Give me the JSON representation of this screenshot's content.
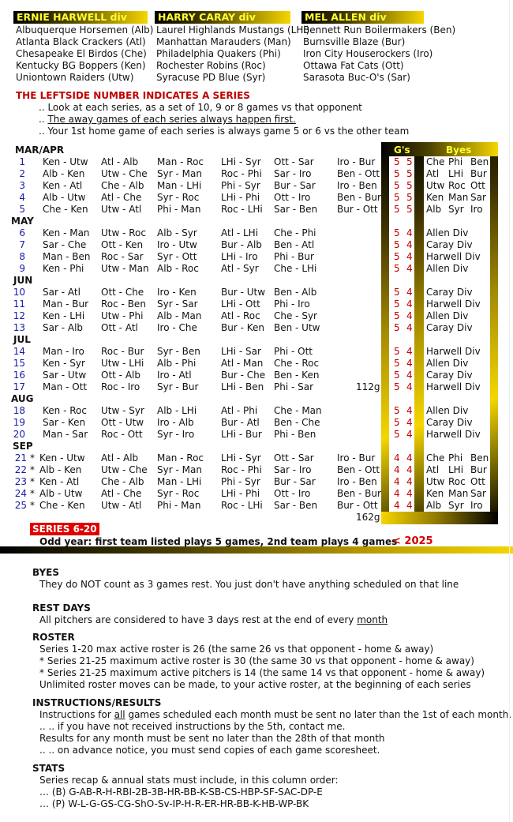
{
  "divisions": [
    {
      "title": "ERNIE HARWELL div",
      "teams": [
        "Albuquerque Horsemen (Alb)",
        "Atlanta Black Crackers (Atl)",
        "Chesapeake El Birdos (Che)",
        "Kentucky BG Boppers (Ken)",
        "Uniontown Raiders (Utw)"
      ]
    },
    {
      "title": "HARRY CARAY div",
      "teams": [
        "Laurel Highlands Mustangs (LHi)",
        "Manhattan Marauders (Man)",
        "Philadelphia Quakers (Phi)",
        "Rochester Robins (Roc)",
        "Syracuse PD Blue (Syr)"
      ]
    },
    {
      "title": "MEL ALLEN div",
      "teams": [
        "Bennett Run Boilermakers (Ben)",
        "Burnsville Blaze (Bur)",
        "Iron City Houserockers (Iro)",
        "Ottawa Fat Cats (Ott)",
        "Sarasota Buc-O's (Sar)"
      ]
    }
  ],
  "intro": {
    "heading": "THE LEFTSIDE NUMBER INDICATES A SERIES",
    "lines": [
      ".. Look at each series, as a set of 10, 9 or 8 games vs that opponent",
      ".. ",
      "The away games of each series always happen first.",
      ".. Your 1st home game of each series is always game 5 or 6 vs the other team"
    ]
  },
  "panel": {
    "games_header": "G's",
    "byes_header": "Byes"
  },
  "months": [
    "MAR/APR",
    "MAY",
    "JUN",
    "JUL",
    "AUG",
    "SEP"
  ],
  "series": [
    {
      "n": "1",
      "star": "",
      "m": [
        "Ken - Utw",
        "Atl - Alb",
        "Man - Roc",
        "LHi - Syr",
        "Ott - Sar",
        "Iro - Bur"
      ],
      "g": [
        "5",
        "5"
      ],
      "byes": [
        "Che",
        "Phi",
        "Ben"
      ],
      "total": ""
    },
    {
      "n": "2",
      "star": "",
      "m": [
        "Alb - Ken",
        "Utw - Che",
        "Syr - Man",
        "Roc - Phi",
        "Sar - Iro",
        "Ben - Ott"
      ],
      "g": [
        "5",
        "5"
      ],
      "byes": [
        "Atl",
        "LHi",
        "Bur"
      ],
      "total": ""
    },
    {
      "n": "3",
      "star": "",
      "m": [
        "Ken - Atl",
        "Che - Alb",
        "Man - LHi",
        "Phi - Syr",
        "Bur - Sar",
        "Iro - Ben"
      ],
      "g": [
        "5",
        "5"
      ],
      "byes": [
        "Utw",
        "Roc",
        "Ott"
      ],
      "total": ""
    },
    {
      "n": "4",
      "star": "",
      "m": [
        "Alb - Utw",
        "Atl - Che",
        "Syr - Roc",
        "LHi - Phi",
        "Ott - Iro",
        "Ben - Bur"
      ],
      "g": [
        "5",
        "5"
      ],
      "byes": [
        "Ken",
        "Man",
        "Sar"
      ],
      "total": ""
    },
    {
      "n": "5",
      "star": "",
      "m": [
        "Che - Ken",
        "Utw - Atl",
        "Phi - Man",
        "Roc - LHi",
        "Sar - Ben",
        "Bur - Ott"
      ],
      "g": [
        "5",
        "5"
      ],
      "byes": [
        "Alb",
        "Syr",
        "Iro"
      ],
      "total": ""
    },
    {
      "n": "6",
      "star": "",
      "m": [
        "Ken - Man",
        "Utw - Roc",
        "Alb - Syr",
        "Atl - LHi",
        "Che - Phi",
        ""
      ],
      "g": [
        "5",
        "4"
      ],
      "byes": [
        "Allen Div"
      ],
      "total": ""
    },
    {
      "n": "7",
      "star": "",
      "m": [
        "Sar - Che",
        "Ott - Ken",
        "Iro - Utw",
        "Bur - Alb",
        "Ben - Atl",
        ""
      ],
      "g": [
        "5",
        "4"
      ],
      "byes": [
        "Caray Div"
      ],
      "total": ""
    },
    {
      "n": "8",
      "star": "",
      "m": [
        "Man - Ben",
        "Roc - Sar",
        "Syr - Ott",
        "LHi - Iro",
        "Phi - Bur",
        ""
      ],
      "g": [
        "5",
        "4"
      ],
      "byes": [
        "Harwell Div"
      ],
      "total": ""
    },
    {
      "n": "9",
      "star": "",
      "m": [
        "Ken - Phi",
        "Utw - Man",
        "Alb - Roc",
        "Atl - Syr",
        "Che - LHi",
        ""
      ],
      "g": [
        "5",
        "4"
      ],
      "byes": [
        "Allen Div"
      ],
      "total": ""
    },
    {
      "n": "10",
      "star": "",
      "m": [
        "Sar - Atl",
        "Ott - Che",
        "Iro - Ken",
        "Bur - Utw",
        "Ben - Alb",
        ""
      ],
      "g": [
        "5",
        "4"
      ],
      "byes": [
        "Caray Div"
      ],
      "total": ""
    },
    {
      "n": "11",
      "star": "",
      "m": [
        "Man - Bur",
        "Roc - Ben",
        "Syr - Sar",
        "LHi - Ott",
        "Phi - Iro",
        ""
      ],
      "g": [
        "5",
        "4"
      ],
      "byes": [
        "Harwell Div"
      ],
      "total": ""
    },
    {
      "n": "12",
      "star": "",
      "m": [
        "Ken - LHi",
        "Utw - Phi",
        "Alb - Man",
        "Atl - Roc",
        "Che - Syr",
        ""
      ],
      "g": [
        "5",
        "4"
      ],
      "byes": [
        "Allen Div"
      ],
      "total": ""
    },
    {
      "n": "13",
      "star": "",
      "m": [
        "Sar - Alb",
        "Ott - Atl",
        "Iro - Che",
        "Bur - Ken",
        "Ben - Utw",
        ""
      ],
      "g": [
        "5",
        "4"
      ],
      "byes": [
        "Caray Div"
      ],
      "total": ""
    },
    {
      "n": "14",
      "star": "",
      "m": [
        "Man - Iro",
        "Roc - Bur",
        "Syr - Ben",
        "LHi - Sar",
        "Phi - Ott",
        ""
      ],
      "g": [
        "5",
        "4"
      ],
      "byes": [
        "Harwell Div"
      ],
      "total": ""
    },
    {
      "n": "15",
      "star": "",
      "m": [
        "Ken - Syr",
        "Utw - LHi",
        "Alb - Phi",
        "Atl - Man",
        "Che - Roc",
        ""
      ],
      "g": [
        "5",
        "4"
      ],
      "byes": [
        "Allen Div"
      ],
      "total": ""
    },
    {
      "n": "16",
      "star": "",
      "m": [
        "Sar - Utw",
        "Ott - Alb",
        "Iro - Atl",
        "Bur - Che",
        "Ben - Ken",
        ""
      ],
      "g": [
        "5",
        "4"
      ],
      "byes": [
        "Caray Div"
      ],
      "total": ""
    },
    {
      "n": "17",
      "star": "",
      "m": [
        "Man - Ott",
        "Roc - Iro",
        "Syr - Bur",
        "LHi - Ben",
        "Phi - Sar",
        ""
      ],
      "g": [
        "5",
        "4"
      ],
      "byes": [
        "Harwell Div"
      ],
      "total": "112g"
    },
    {
      "n": "18",
      "star": "",
      "m": [
        "Ken - Roc",
        "Utw - Syr",
        "Alb - LHi",
        "Atl - Phi",
        "Che - Man",
        ""
      ],
      "g": [
        "5",
        "4"
      ],
      "byes": [
        "Allen Div"
      ],
      "total": ""
    },
    {
      "n": "19",
      "star": "",
      "m": [
        "Sar - Ken",
        "Ott - Utw",
        "Iro - Alb",
        "Bur - Atl",
        "Ben - Che",
        ""
      ],
      "g": [
        "5",
        "4"
      ],
      "byes": [
        "Caray Div"
      ],
      "total": ""
    },
    {
      "n": "20",
      "star": "",
      "m": [
        "Man - Sar",
        "Roc - Ott",
        "Syr - Iro",
        "LHi - Bur",
        "Phi - Ben",
        ""
      ],
      "g": [
        "5",
        "4"
      ],
      "byes": [
        "Harwell Div"
      ],
      "total": ""
    },
    {
      "n": "21",
      "star": "*",
      "m": [
        "Ken - Utw",
        "Atl - Alb",
        "Man - Roc",
        "LHi - Syr",
        "Ott - Sar",
        "Iro - Bur"
      ],
      "g": [
        "4",
        "4"
      ],
      "byes": [
        "Che",
        "Phi",
        "Ben"
      ],
      "total": ""
    },
    {
      "n": "22",
      "star": "*",
      "m": [
        "Alb - Ken",
        "Utw - Che",
        "Syr - Man",
        "Roc - Phi",
        "Sar - Iro",
        "Ben - Ott"
      ],
      "g": [
        "4",
        "4"
      ],
      "byes": [
        "Atl",
        "LHi",
        "Bur"
      ],
      "total": ""
    },
    {
      "n": "23",
      "star": "*",
      "m": [
        "Ken - Atl",
        "Che - Alb",
        "Man - LHi",
        "Phi - Syr",
        "Bur - Sar",
        "Iro - Ben"
      ],
      "g": [
        "4",
        "4"
      ],
      "byes": [
        "Utw",
        "Roc",
        "Ott"
      ],
      "total": ""
    },
    {
      "n": "24",
      "star": "*",
      "m": [
        "Alb - Utw",
        "Atl - Che",
        "Syr - Roc",
        "LHi - Phi",
        "Ott - Iro",
        "Ben - Bur"
      ],
      "g": [
        "4",
        "4"
      ],
      "byes": [
        "Ken",
        "Man",
        "Sar"
      ],
      "total": ""
    },
    {
      "n": "25",
      "star": "*",
      "m": [
        "Che - Ken",
        "Utw - Atl",
        "Phi - Man",
        "Roc - LHi",
        "Sar - Ben",
        "Bur - Ott"
      ],
      "g": [
        "4",
        "4"
      ],
      "byes": [
        "Alb",
        "Syr",
        "Iro"
      ],
      "total": ""
    }
  ],
  "season_total": "162g",
  "series_badge": "SERIES 6-20",
  "odd_year_note": "Odd year: first team listed plays 5 games, 2nd team plays 4 games",
  "year_marker": "< 2025",
  "sections": {
    "byes": {
      "title": "BYES",
      "lines": [
        "They do NOT count as 3 games rest. You just don't have anything scheduled on that line"
      ]
    },
    "rest": {
      "title": "REST DAYS",
      "line_pre": "All pitchers are considered to have 3 days rest at the end of every ",
      "line_u": "month"
    },
    "roster": {
      "title": "ROSTER",
      "lines": [
        "Series 1-20 max active roster is 26 (the same 26 vs that opponent - home & away)",
        "* Series 21-25 maximum active roster is 30 (the same 30 vs that opponent - home & away)",
        "* Series 21-25 maximum active pitchers is 14 (the same 14 vs that opponent - home & away)",
        "Unlimited roster moves can be made, to your active roster, at the beginning of each series"
      ]
    },
    "instructions": {
      "title": "INSTRUCTIONS/RESULTS",
      "l1_pre": "Instructions for ",
      "l1_u": "all",
      "l1_post": " games scheduled each month must be sent no later than the 1st of each month.",
      "lines": [
        ".. .. if you have not received instructions by the 5th, contact me.",
        "Results for any month must be sent no later than the 28th of that month",
        ".. .. on advance notice, you must send copies of each game scoresheet."
      ]
    },
    "stats": {
      "title": "STATS",
      "lines": [
        "Series recap & annual stats must include, in this column order:",
        "… (B) G-AB-R-H-RBI-2B-3B-HR-BB-K-SB-CS-HBP-SF-SAC-DP-E",
        "… (P) W-L-G-GS-CG-ShO-Sv-IP-H-R-ER-HR-BB-K-HB-WP-BK"
      ]
    }
  }
}
